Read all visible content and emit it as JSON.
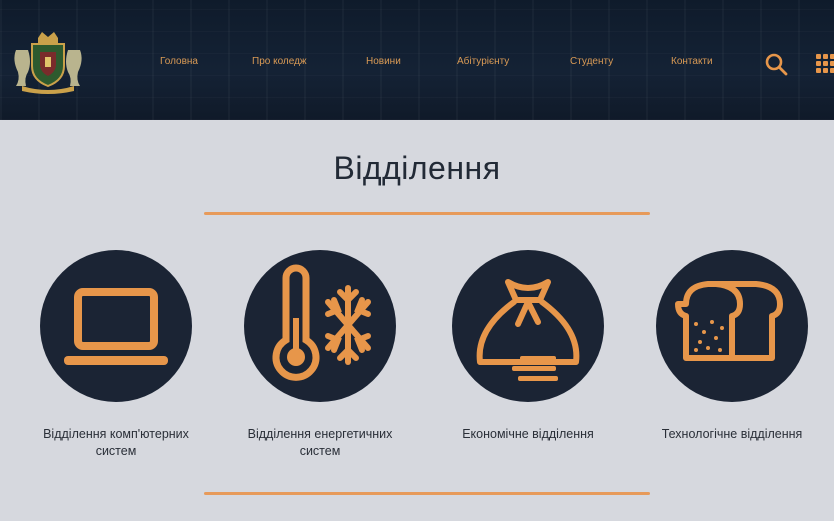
{
  "header": {
    "nav": [
      {
        "label": "Головна"
      },
      {
        "label": "Про коледж"
      },
      {
        "label": "Новини"
      },
      {
        "label": "Абітурієнту"
      },
      {
        "label": "Студенту"
      },
      {
        "label": "Контакти"
      }
    ],
    "icons": {
      "search": "search-icon",
      "menu": "grid-menu-icon",
      "logo": "college-coat-of-arms"
    }
  },
  "main": {
    "title": "Відділення",
    "departments": [
      {
        "label": "Відділення комп'ютерних систем",
        "icon": "laptop-icon"
      },
      {
        "label": "Відділення енергетичних систем",
        "icon": "thermometer-snowflake-icon"
      },
      {
        "label": "Економічне відділення",
        "icon": "money-bag-icon"
      },
      {
        "label": "Технологічне відділення",
        "icon": "bread-icon"
      }
    ]
  },
  "colors": {
    "accent": "#e7964a",
    "header_bg": "#142235",
    "circle_bg": "#1b2434",
    "page_bg": "#d6d8de"
  }
}
